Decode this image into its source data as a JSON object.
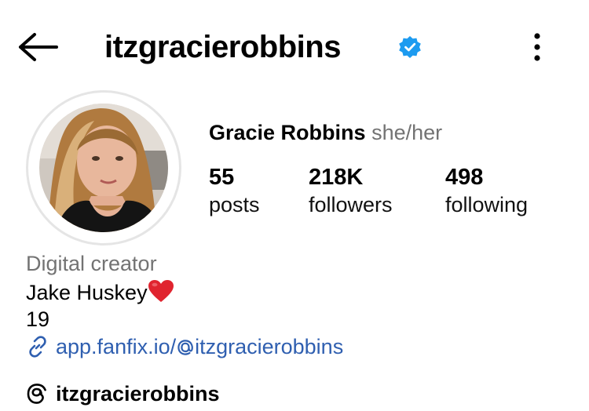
{
  "header": {
    "username": "itzgracierobbins",
    "verified_color": "#1d9bf0"
  },
  "profile": {
    "full_name": "Gracie Robbins",
    "pronouns": "she/her",
    "stats": [
      {
        "value": "55",
        "label": "posts"
      },
      {
        "value": "218K",
        "label": "followers"
      },
      {
        "value": "498",
        "label": "following"
      }
    ],
    "category": "Digital creator",
    "bio_line1": "Jake Huskey",
    "bio_line2": "19",
    "link_prefix": "app.fanfix.io/",
    "link_handle": "itzgracierobbins",
    "threads_handle": "itzgracierobbins"
  },
  "colors": {
    "link": "#2f5fb0",
    "muted": "#737373",
    "heart": "#e0242f"
  },
  "icons": {
    "back": "arrow-left-icon",
    "more": "vertical-dots-icon",
    "verified": "verified-badge-icon",
    "link": "link-icon",
    "threads": "threads-icon",
    "heart": "heart-emoji-icon"
  }
}
